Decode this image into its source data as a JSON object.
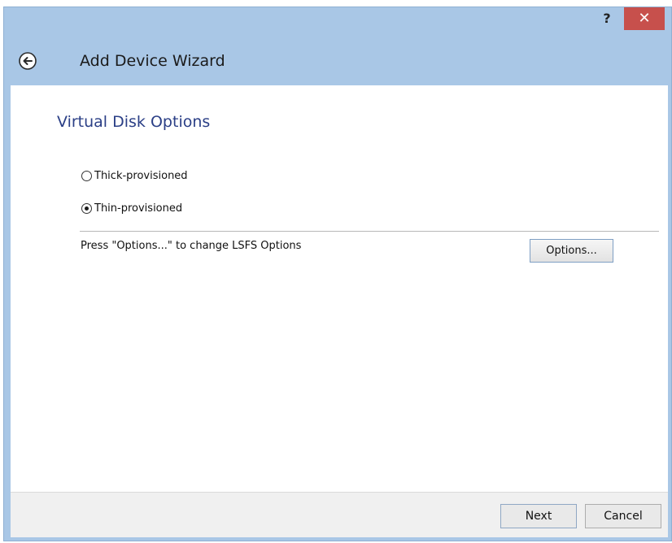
{
  "titlebar": {
    "help_label": "?",
    "close_label": "✕"
  },
  "header": {
    "title": "Add Device Wizard",
    "back_icon": "back-arrow-circle-icon"
  },
  "main": {
    "section_title": "Virtual Disk Options",
    "provisioning": {
      "options": [
        {
          "label": "Thick-provisioned",
          "selected": false
        },
        {
          "label": "Thin-provisioned",
          "selected": true
        }
      ]
    },
    "options_hint": "Press \"Options...\" to change LSFS Options",
    "options_button": "Options..."
  },
  "footer": {
    "next_label": "Next",
    "cancel_label": "Cancel"
  },
  "colors": {
    "title_bar": "#a9c7e6",
    "close_button": "#c7504c",
    "section_title": "#2b3f86"
  }
}
